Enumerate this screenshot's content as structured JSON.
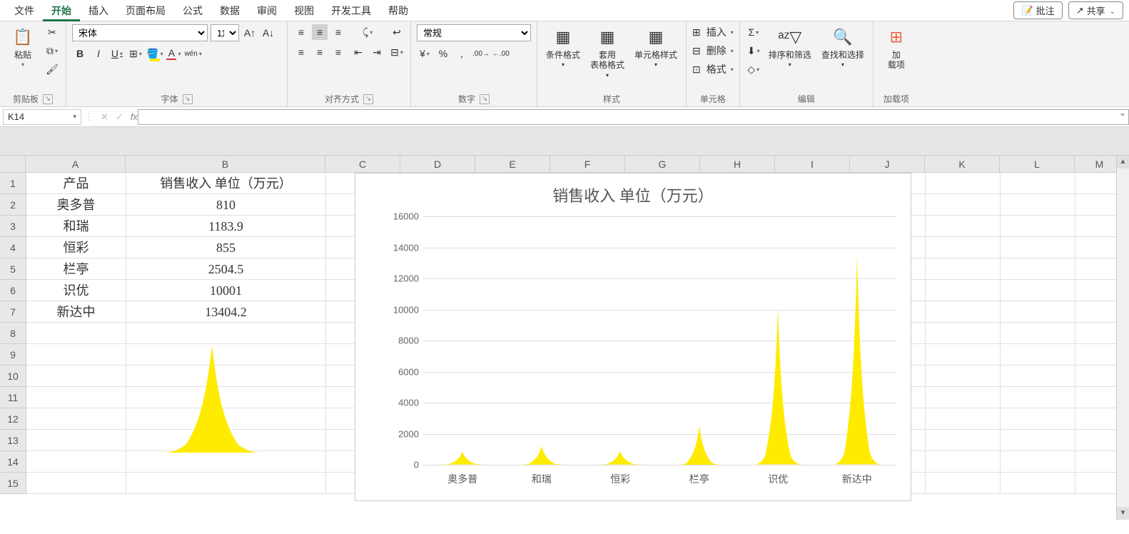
{
  "tabs": {
    "items": [
      "文件",
      "开始",
      "插入",
      "页面布局",
      "公式",
      "数据",
      "审阅",
      "视图",
      "开发工具",
      "帮助"
    ],
    "active": "开始",
    "comments": "批注",
    "share": "共享"
  },
  "ribbon": {
    "clipboard": {
      "paste": "粘贴",
      "label": "剪贴板"
    },
    "font": {
      "name": "宋体",
      "size": "11",
      "label": "字体",
      "bold": "B",
      "italic": "I",
      "underline": "U",
      "phonetic": "wén"
    },
    "alignment": {
      "label": "对齐方式",
      "wrap": "自动换行",
      "merge": "合并后居中"
    },
    "number": {
      "format": "常规",
      "label": "数字"
    },
    "styles": {
      "cond": "条件格式",
      "table": "套用\n表格格式",
      "cell": "单元格样式",
      "label": "样式"
    },
    "cells": {
      "insert": "插入",
      "delete": "删除",
      "format": "格式",
      "label": "单元格"
    },
    "editing": {
      "sort": "排序和筛选",
      "find": "查找和选择",
      "label": "编辑"
    },
    "addins": {
      "addin": "加\n载项",
      "label": "加载项"
    }
  },
  "formula_bar": {
    "name_box": "K14",
    "fx": "fx"
  },
  "grid": {
    "columns": [
      "A",
      "B",
      "C",
      "D",
      "E",
      "F",
      "G",
      "H",
      "I",
      "J",
      "K",
      "L",
      "M"
    ],
    "rows": 15,
    "colA_header": "产品",
    "colB_header": "销售收入 单位（万元）",
    "data": [
      {
        "product": "奥多普",
        "value": "810"
      },
      {
        "product": "和瑞",
        "value": "1183.9"
      },
      {
        "product": "恒彩",
        "value": "855"
      },
      {
        "product": "栏亭",
        "value": "2504.5"
      },
      {
        "product": "识优",
        "value": "10001"
      },
      {
        "product": "新达中",
        "value": "13404.2"
      }
    ]
  },
  "chart_data": {
    "type": "bar",
    "title": "销售收入 单位（万元）",
    "categories": [
      "奥多普",
      "和瑞",
      "恒彩",
      "栏亭",
      "识优",
      "新达中"
    ],
    "values": [
      810,
      1183.9,
      855,
      2504.5,
      10001,
      13404.2
    ],
    "ylim": [
      0,
      16000
    ],
    "yticks": [
      0,
      2000,
      4000,
      6000,
      8000,
      10000,
      12000,
      14000,
      16000
    ],
    "xlabel": "",
    "ylabel": ""
  }
}
